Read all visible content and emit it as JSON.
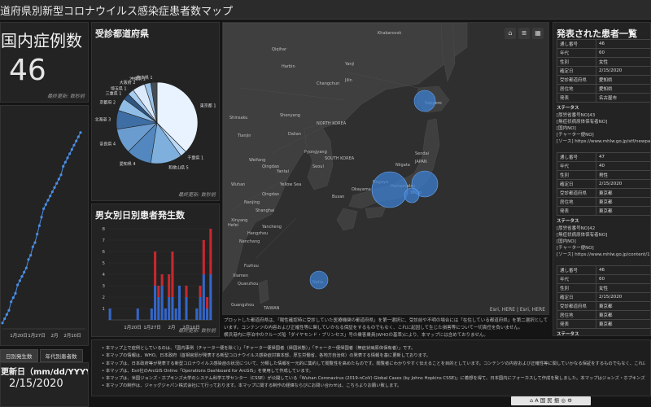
{
  "app": {
    "title": "道府県別新型コロナウイルス感染症患者数マップ"
  },
  "total": {
    "label": "国内症例数",
    "value": "46",
    "footer": "最終更新: 数秒前"
  },
  "prefecture": {
    "title": "受診都道府県",
    "footer": "最終更新: 数秒前"
  },
  "gender": {
    "title": "男女別日別患者発生数",
    "footer": "最終更新: 数秒前"
  },
  "timeline": {
    "x_labels": [
      "1月20日",
      "1月27日",
      "2月",
      "2月10日"
    ]
  },
  "map": {
    "attribution": "Esri, HERE | Esri, HERE",
    "labels": [
      "Khabarovsk",
      "Qiqihar",
      "Harbin",
      "Yanji",
      "Sapporo",
      "Shenyang",
      "Dalian",
      "Pyongyang",
      "SOUTH KOREA",
      "NORTH KOREA",
      "Seoul",
      "Busan",
      "Tianjin",
      "Weifang",
      "Qingdao",
      "Yantai",
      "Nanjing",
      "Shanghai",
      "Hangzhou",
      "Yancheng",
      "Wuhan",
      "Nanchang",
      "Fuzhou",
      "Xiamen",
      "Quanzhou",
      "Guangzhou",
      "TAIWAN",
      "Okayama",
      "Nagoya",
      "Tokyo",
      "JAPAN",
      "Hamamatsu",
      "Sendai",
      "Niigata",
      "Changchun",
      "Jilin",
      "Shinsaku",
      "Naha",
      "Qingdao",
      "Hefei",
      "Xinyang",
      "Yellow Sea"
    ],
    "tools": [
      "⌂",
      "≣",
      "▦"
    ]
  },
  "map_note": "プロットした都道府県は、「陽性確認時に受診していた医療機関の都道府県」を第一選択に、受診前や不明の場合には「在住している都道府県」を第二選択としています。コンテンツの内容および正確性等に関していかなる保証をするものでもなく、これに起因して生じた損害等について一切責任を負いません。\n横浜港内に停泊中のクルーズ船「ダイヤモンド・プリンセス」号の乗客乗員(WHOの基準)により、本マップには含めておりません。",
  "list": {
    "title": "発表された患者一覧",
    "keys": [
      "通し番号",
      "年代",
      "性別",
      "確定日",
      "受診都道府県",
      "居住地",
      "発表",
      "ステータス"
    ],
    "records": [
      {
        "values": [
          "46",
          "60",
          "女性",
          "2/15/2020",
          "愛知県",
          "愛知県",
          "名古屋市",
          ""
        ],
        "lines": [
          "[厚労省番号NO]43",
          "[無症状病原体保有者NO]",
          "[国内NO]",
          "[チャーター便NO]",
          "[ソース] https://www.mhlw.go.jp/stf/newpage_09545.html"
        ]
      },
      {
        "values": [
          "47",
          "40",
          "男性",
          "2/15/2020",
          "東京都",
          "東京都",
          "東京都",
          ""
        ],
        "lines": [
          "[厚労省番号NO]42",
          "[無症状病原体保有者NO]",
          "[国内NO]",
          "[チャーター便NO]",
          "[ソース] https://www.mhlw.go.jp/content/10906000/000598.pdf"
        ]
      },
      {
        "values": [
          "46",
          "60",
          "女性",
          "2/15/2020",
          "東京都",
          "東京都",
          "東京都",
          ""
        ],
        "lines": [
          "[厚労省番号NO]41",
          "[無症状病原体保有者NO]",
          "[国内NO]"
        ]
      }
    ]
  },
  "notes": [
    "本マップ上で症例としているのは、「国内事例（チャーター便を除く）」「チャーター便帰国者（帰国状態）」「チャーター便帰国者（無症状病原体保有者）」です。",
    "本マップの情報は、WHO、日本政府（首相官邸が発表する新型コロナウイルス感染症対策本部、厚生労働省、各地方自治体）の発表する情報を基に更新しております。",
    "本マップは、日本政府等が発表する新型コロナウイルス感染症の状況について、分類した情報を一元的に集約して閲覧性を高めたものです。閲覧者にわかりやすく伝えることを目的としています。コンテンツの内容および正確性等に関していかなる保証をするものでもなく、これに起因して生じた損害等につき一切責任を負いません。",
    "本マップは、Esri社のArcGIS Online「Operations Dashboard for ArcGIS」を使用して作成しています。",
    "本マップは、米国ジョンズ・ホプキンズ大学のシステム科学工学センター（CSSE）が公開している「Wuhan Coronavirus (2019-nCoV) Global Cases (by Johns Hopkins CSSE)」に着想を得て、日本国内にフォーカスして作成を致しました。本マップはジョンズ・ホプキンズ大学とは一切関係ありません。",
    "本マップの制作は、ジャッグジャパン株式会社にて行っております。本マップに関する制作の経緯ならびにお問い合わせは、こちらよりお願い致します。"
  ],
  "update": {
    "label": "更新日（mm/dd/YYYY）",
    "value": "2/15/2020"
  },
  "tabs": [
    "日別発生数",
    "年代別患者数"
  ],
  "toolbar": {
    "text": "⌂ A 国 民 振 ◎ ⚙"
  },
  "chart_data": [
    {
      "type": "pie",
      "title": "受診都道府県",
      "categories": [
        "東京都",
        "千葉県",
        "和歌山県",
        "愛知県",
        "奈良県",
        "北海道",
        "京都府",
        "三重県",
        "埼玉県",
        "大阪府",
        "沖縄県",
        "熊本県"
      ],
      "values": [
        15,
        1,
        5,
        4,
        4,
        3,
        2,
        1,
        1,
        2,
        1,
        1
      ],
      "value_labels": [
        "東京都 1",
        "千葉県 1",
        "和歌山県 5",
        "愛知県 4",
        "奈良県 4",
        "北海道 3",
        "京都府 2",
        "三重県 1",
        "埼玉県 1",
        "大阪府 2",
        "沖縄県 1",
        "熊本県 1"
      ],
      "colors": [
        "#e8f3ff",
        "#bcd9f5",
        "#7fb0dd",
        "#5288bf",
        "#6b9ccf",
        "#3e6ea3",
        "#8fbde6",
        "#2f5580",
        "#a8cdef",
        "#dceafb",
        "#9cc4ea",
        "#444c55"
      ]
    },
    {
      "type": "line",
      "title": "",
      "x_labels": [
        "1月20日",
        "1月27日",
        "2月",
        "2月10日"
      ],
      "values": [
        1,
        2,
        3,
        4,
        6,
        7,
        8,
        10,
        11,
        12,
        13,
        14,
        16,
        17,
        19,
        20,
        22,
        24,
        26,
        28,
        29,
        30,
        31,
        32,
        33,
        34,
        35,
        36,
        38,
        39,
        40,
        41,
        42,
        43,
        44,
        45,
        46
      ],
      "ylim": [
        0,
        50
      ],
      "color": "#4a8ee6"
    },
    {
      "type": "bar",
      "title": "男女別日別患者発生数",
      "y_ticks": [
        "8",
        "7",
        "6",
        "5",
        "4",
        "3",
        "2",
        "1"
      ],
      "x_labels": [
        "1月20日",
        "1月27日",
        "2月",
        "2月10日"
      ],
      "series": [
        {
          "name": "",
          "color": "#3466c8",
          "values": [
            1,
            0,
            0,
            0,
            0,
            0,
            0,
            0,
            1,
            0,
            0,
            0,
            1,
            3,
            2,
            3,
            1,
            2,
            2,
            1,
            3,
            0,
            2,
            0,
            0,
            1,
            2,
            4,
            1,
            4
          ]
        },
        {
          "name": "",
          "color": "#c8282e",
          "values": [
            0,
            0,
            0,
            0,
            0,
            0,
            0,
            0,
            0,
            0,
            0,
            0,
            0,
            3,
            1,
            1,
            0,
            2,
            4,
            0,
            0,
            0,
            1,
            0,
            0,
            0,
            1,
            3,
            1,
            4
          ]
        }
      ],
      "ylim": [
        0,
        8
      ]
    }
  ]
}
